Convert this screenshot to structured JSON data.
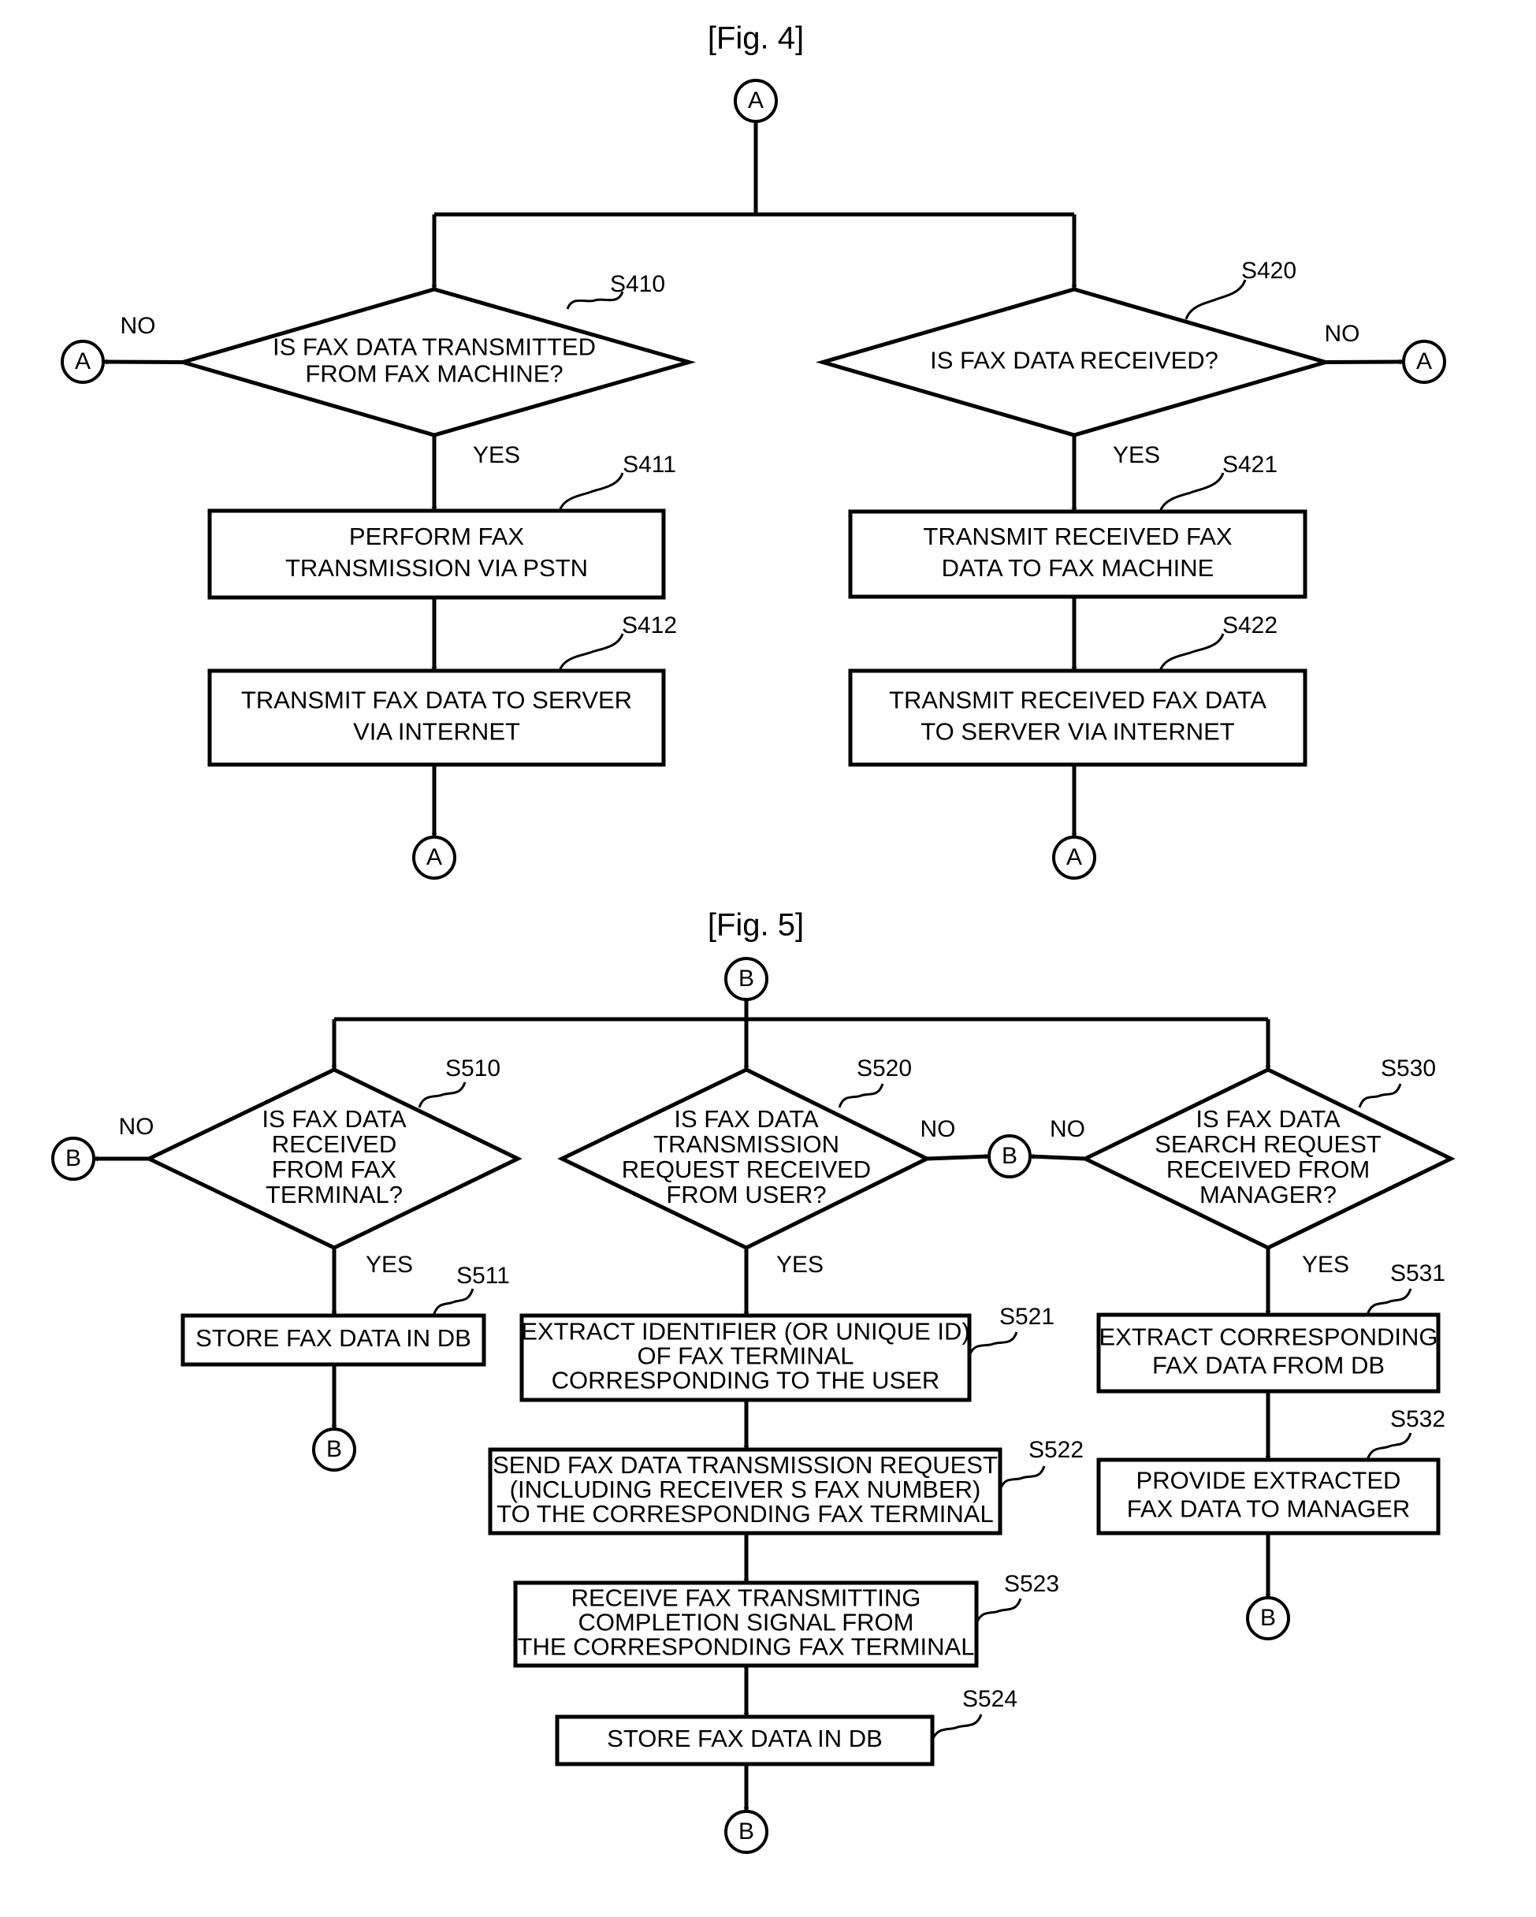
{
  "figures": [
    {
      "id": "fig4",
      "title": "[Fig. 4]",
      "connector_label": "A",
      "branches": [
        {
          "decision": {
            "step": "S410",
            "lines": [
              "IS FAX DATA TRANSMITTED",
              "FROM FAX MACHINE?"
            ],
            "no_label": "NO",
            "yes_label": "YES",
            "no_target": "A"
          },
          "processes": [
            {
              "step": "S411",
              "lines": [
                "PERFORM FAX",
                "TRANSMISSION VIA PSTN"
              ]
            },
            {
              "step": "S412",
              "lines": [
                "TRANSMIT FAX DATA TO SERVER",
                "VIA INTERNET"
              ]
            }
          ],
          "end": "A"
        },
        {
          "decision": {
            "step": "S420",
            "lines": [
              "IS FAX DATA RECEIVED?"
            ],
            "no_label": "NO",
            "yes_label": "YES",
            "no_target": "A"
          },
          "processes": [
            {
              "step": "S421",
              "lines": [
                "TRANSMIT RECEIVED FAX",
                "DATA TO FAX MACHINE"
              ]
            },
            {
              "step": "S422",
              "lines": [
                "TRANSMIT RECEIVED FAX DATA",
                "TO SERVER VIA INTERNET"
              ]
            }
          ],
          "end": "A"
        }
      ]
    },
    {
      "id": "fig5",
      "title": "[Fig. 5]",
      "connector_label": "B",
      "branches": [
        {
          "decision": {
            "step": "S510",
            "lines": [
              "IS FAX DATA",
              "RECEIVED",
              "FROM FAX",
              "TERMINAL?"
            ],
            "no_label": "NO",
            "yes_label": "YES",
            "no_target": "B"
          },
          "processes": [
            {
              "step": "S511",
              "lines": [
                "STORE FAX DATA IN DB"
              ]
            }
          ],
          "end": "B"
        },
        {
          "decision": {
            "step": "S520",
            "lines": [
              "IS FAX DATA",
              "TRANSMISSION",
              "REQUEST RECEIVED",
              "FROM USER?"
            ],
            "no_label": "NO",
            "yes_label": "YES",
            "no_target": "B"
          },
          "processes": [
            {
              "step": "S521",
              "lines": [
                "EXTRACT IDENTIFIER (OR UNIQUE ID)",
                "OF FAX TERMINAL",
                "CORRESPONDING TO THE USER"
              ]
            },
            {
              "step": "S522",
              "lines": [
                "SEND FAX DATA TRANSMISSION REQUEST",
                "(INCLUDING RECEIVER S FAX NUMBER)",
                "TO THE CORRESPONDING FAX TERMINAL"
              ]
            },
            {
              "step": "S523",
              "lines": [
                "RECEIVE FAX TRANSMITTING",
                "COMPLETION SIGNAL FROM",
                "THE CORRESPONDING FAX TERMINAL"
              ]
            },
            {
              "step": "S524",
              "lines": [
                "STORE FAX DATA IN DB"
              ]
            }
          ],
          "end": "B"
        },
        {
          "decision": {
            "step": "S530",
            "lines": [
              "IS FAX DATA",
              "SEARCH REQUEST",
              "RECEIVED FROM",
              "MANAGER?"
            ],
            "no_label": "NO",
            "yes_label": "YES",
            "no_target": "B"
          },
          "processes": [
            {
              "step": "S531",
              "lines": [
                "EXTRACT CORRESPONDING",
                "FAX DATA FROM DB"
              ]
            },
            {
              "step": "S532",
              "lines": [
                "PROVIDE EXTRACTED",
                "FAX DATA TO MANAGER"
              ]
            }
          ],
          "end": "B"
        }
      ]
    }
  ]
}
